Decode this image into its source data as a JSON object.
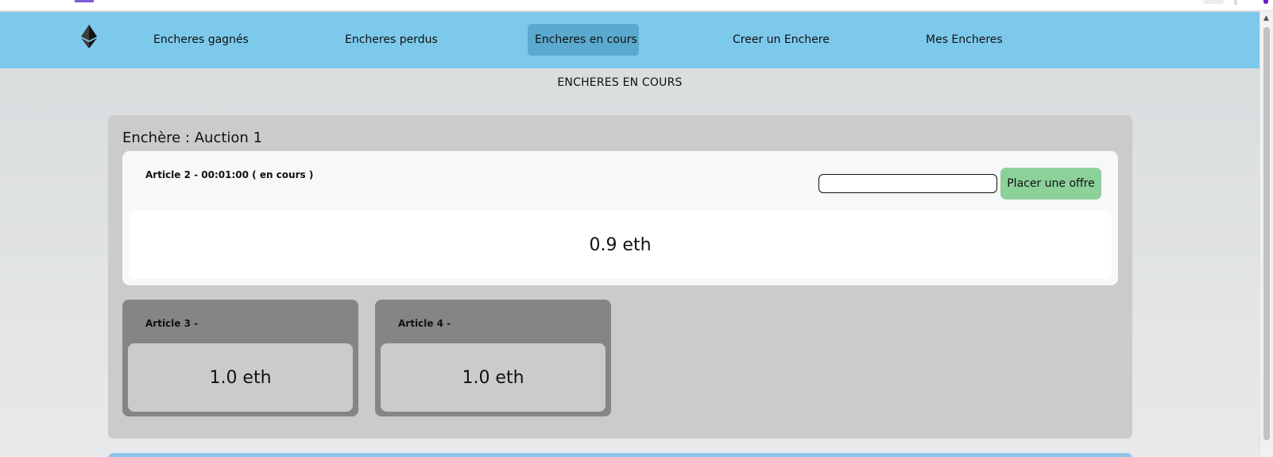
{
  "nav": {
    "logo_icon": "ethereum-icon",
    "items": [
      {
        "label": "Encheres gagnés"
      },
      {
        "label": "Encheres perdus"
      },
      {
        "label": "Encheres en cours",
        "active": true
      },
      {
        "label": "Creer un Enchere"
      },
      {
        "label": "Mes Encheres"
      }
    ]
  },
  "page": {
    "heading": "ENCHERES EN COURS"
  },
  "auction": {
    "title": "Enchère : Auction 1",
    "active_article": {
      "label": "Article 2 - 00:01:00 ( en cours )",
      "price": "0.9 eth",
      "bid_input_value": "",
      "bid_button_label": "Placer une offre"
    },
    "pending_articles": [
      {
        "label": "Article 3 -",
        "price": "1.0 eth"
      },
      {
        "label": "Article 4 -",
        "price": "1.0 eth"
      }
    ]
  },
  "colors": {
    "navbar": "#7dc9ec",
    "nav_active": "#5aa9cf",
    "bid_button": "#8cd09a",
    "panel": "#cbcbcb",
    "pending_card": "#858585"
  }
}
